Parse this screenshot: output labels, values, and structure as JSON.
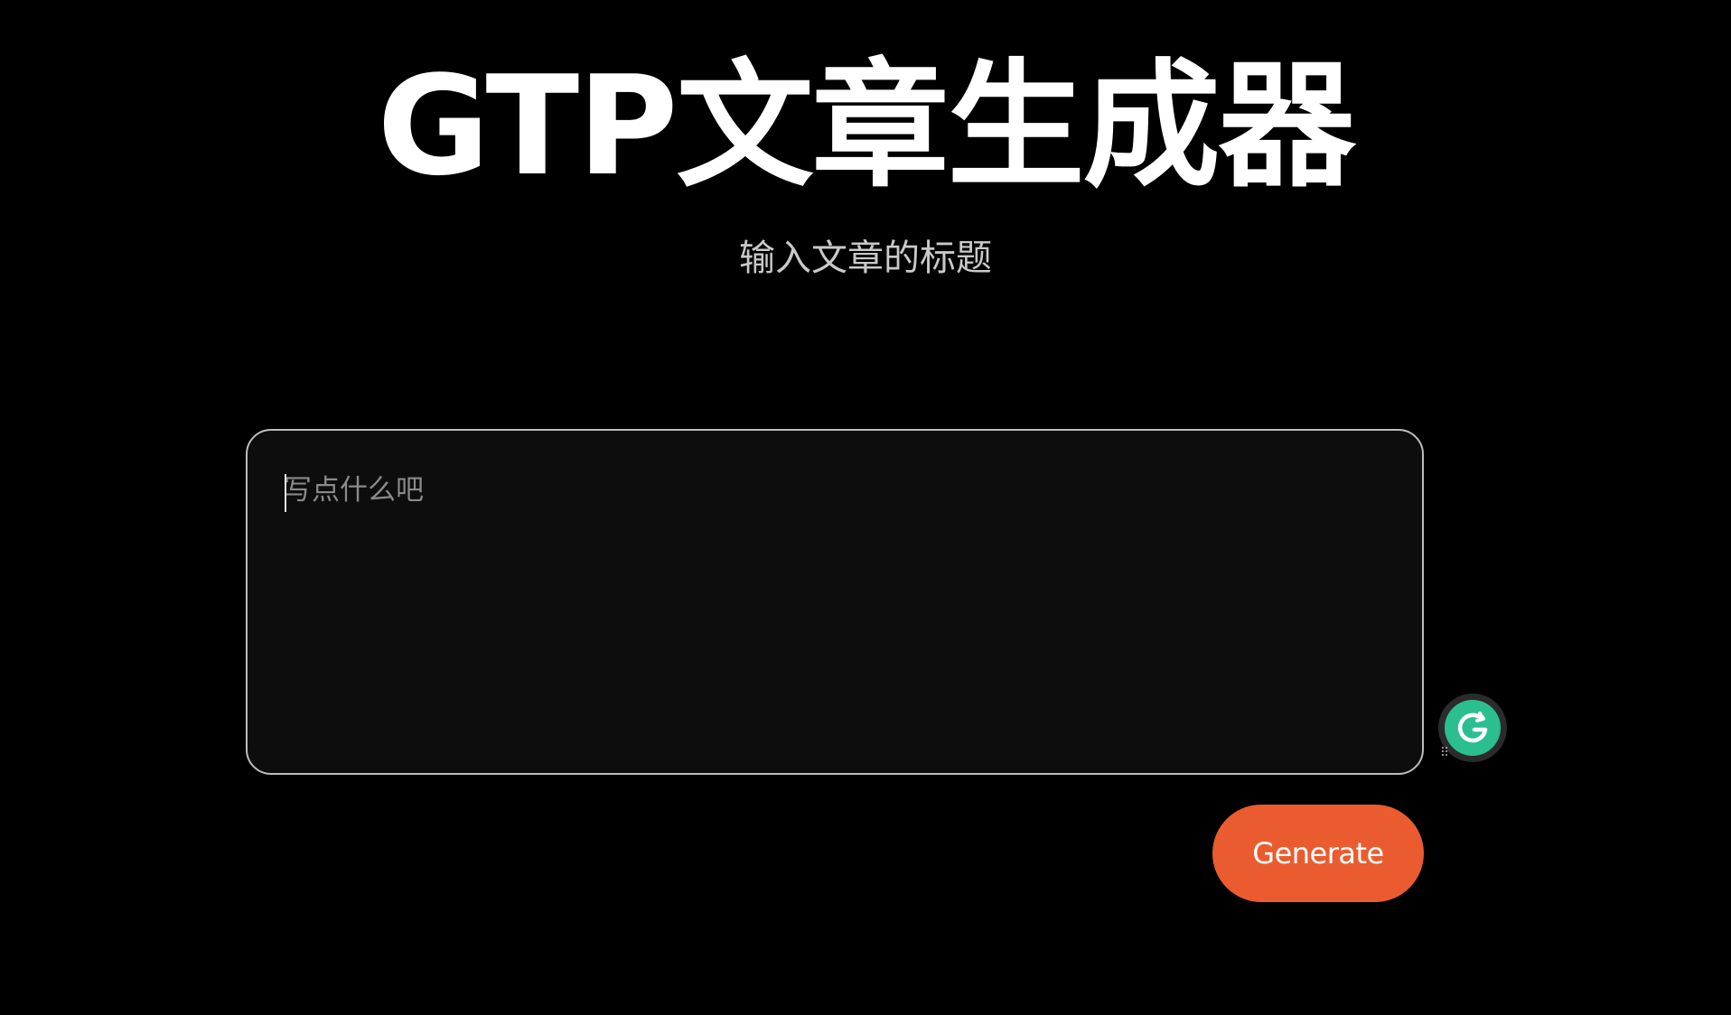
{
  "header": {
    "title": "GTP文章生成器",
    "subtitle": "输入文章的标题"
  },
  "editor": {
    "value": "",
    "placeholder": "写点什么吧"
  },
  "actions": {
    "generate_label": "Generate"
  },
  "colors": {
    "background": "#000000",
    "accent": "#ea5c30",
    "editor_background": "#0d0d0d",
    "editor_border": "#bdbdbd",
    "grammarly_green": "#2bbf90"
  },
  "icons": {
    "grammarly": "grammarly-icon"
  }
}
